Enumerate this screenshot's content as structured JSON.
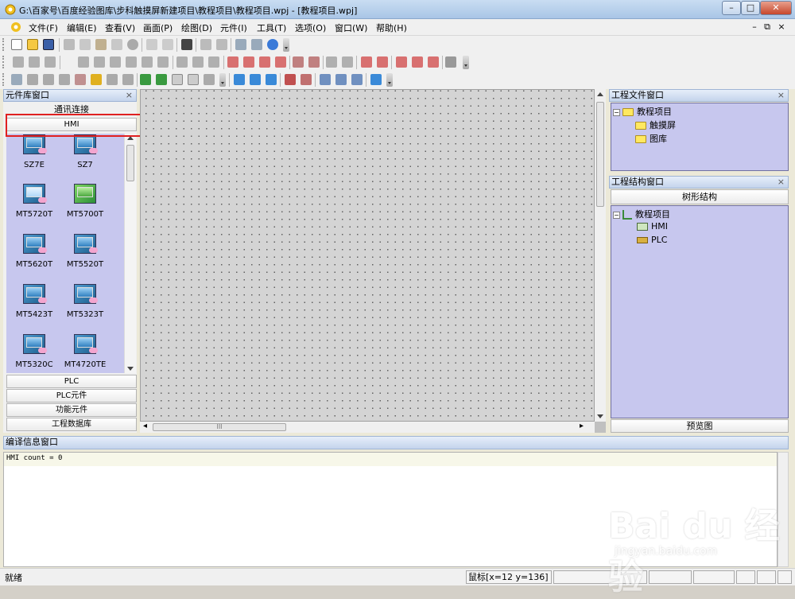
{
  "window": {
    "title": "G:\\百家号\\百度经验图库\\步科触摸屏新建项目\\教程项目\\教程项目.wpj - [教程项目.wpj]",
    "buttons": {
      "minimize": "–",
      "maximize": "□",
      "close": "✕"
    }
  },
  "menu": {
    "items": [
      "文件(F)",
      "编辑(E)",
      "查看(V)",
      "画面(P)",
      "绘图(D)",
      "元件(I)",
      "工具(T)",
      "选项(O)",
      "窗口(W)",
      "帮助(H)"
    ],
    "mdi_buttons": [
      "–",
      "⧉",
      "×"
    ]
  },
  "library": {
    "title": "元件库窗口",
    "close": "×",
    "sections_top": [
      "通讯连接",
      "HMI"
    ],
    "items": [
      {
        "label": "SZ7E",
        "icon": "hmi-monitor-icon"
      },
      {
        "label": "SZ7",
        "icon": "hmi-monitor-icon"
      },
      {
        "label": "MT5720T",
        "icon": "hmi-monitor-icon"
      },
      {
        "label": "MT5700T",
        "icon": "hmi-monitor-green-icon"
      },
      {
        "label": "MT5620T",
        "icon": "hmi-monitor-icon"
      },
      {
        "label": "MT5520T",
        "icon": "hmi-monitor-icon"
      },
      {
        "label": "MT5423T",
        "icon": "hmi-monitor-icon"
      },
      {
        "label": "MT5323T",
        "icon": "hmi-monitor-icon"
      },
      {
        "label": "MT5320C",
        "icon": "hmi-monitor-icon"
      },
      {
        "label": "MT4720TE",
        "icon": "hmi-monitor-icon"
      }
    ],
    "sections_bottom": [
      "PLC",
      "PLC元件",
      "功能元件",
      "工程数据库"
    ]
  },
  "project_files": {
    "title": "工程文件窗口",
    "close": "×",
    "root": "教程项目",
    "children": [
      "触摸屏",
      "图库"
    ],
    "expander": "⊟"
  },
  "project_structure": {
    "title": "工程结构窗口",
    "close": "×",
    "tab": "树形结构",
    "root": "教程项目",
    "children": [
      "HMI",
      "PLC"
    ],
    "preview_tab": "预览图"
  },
  "compile": {
    "title": "编译信息窗口",
    "log": "HMI count = 0"
  },
  "status": {
    "ready": "就绪",
    "mouse": "鼠标[x=12  y=136]"
  },
  "watermark": {
    "brand": "Bai du 经验",
    "url": "jingyan.baidu.com"
  },
  "scroll_arrows": {
    "up": "▲",
    "down": "▼",
    "left": "◂",
    "right": "▸",
    "grip": "III"
  },
  "colors": {
    "library_bg": "#c7c7ee",
    "canvas_bg": "#d4d4d4",
    "highlight_box": "#e02020"
  }
}
